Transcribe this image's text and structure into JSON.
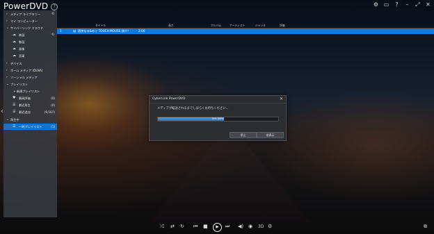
{
  "app": {
    "title": "PowerDVD",
    "help": "?"
  },
  "window_controls": [
    "⚙",
    "▭",
    "?",
    "–",
    "⤢",
    "✕"
  ],
  "sidebar": {
    "items": [
      {
        "label": "メディア ライブラリー",
        "expanded": false
      },
      {
        "label": "マイ コンピューター",
        "expanded": false
      },
      {
        "label": "サイバーリンク クラウド",
        "expanded": true
      },
      {
        "label": "映画"
      },
      {
        "label": "動画"
      },
      {
        "label": "画像"
      },
      {
        "label": "音楽"
      },
      {
        "label": "デバイス",
        "expanded": false
      },
      {
        "label": "ホーム メディア (DLNA)",
        "expanded": false
      },
      {
        "label": "ソーシャル メディア",
        "expanded": false
      },
      {
        "label": "プレイリスト",
        "expanded": true
      },
      {
        "label": "+ 新規プレイリスト"
      },
      {
        "label": "最高評価",
        "count": "(0)"
      },
      {
        "label": "最近再生",
        "count": "(0)"
      },
      {
        "label": "最近追加",
        "count": "(9,167)"
      },
      {
        "label": "再生中",
        "expanded": true
      },
      {
        "label": "一時プレイリスト",
        "count": "(1)"
      }
    ]
  },
  "table": {
    "headers": [
      "タイトル",
      "長さ",
      "アルバム",
      "アーティスト",
      "ジャンル",
      "評価"
    ],
    "selected_row": {
      "index": "1",
      "title": "酒茶なる&めぐ TOUCH MOUSE 顔介？",
      "length": "2:00"
    }
  },
  "dialog": {
    "title": "CyberLink PowerDVD",
    "close": "✕",
    "message": "メディアが転送されるまでしばらくお待ちください...",
    "progress_percent": 55,
    "progress_label": "55% (55%)",
    "buttons": {
      "stop": "停止",
      "cancel": "非表示"
    }
  },
  "controls": {
    "shuffle": "⤮",
    "repeat_list": "⇄",
    "repeat": "↻",
    "prev": "⏮",
    "stop": "■",
    "play": "▶",
    "next": "⏭",
    "volume": "◀)",
    "view": "◉",
    "mode3d": "3D",
    "settings": "⚙",
    "cast": "⧉"
  }
}
